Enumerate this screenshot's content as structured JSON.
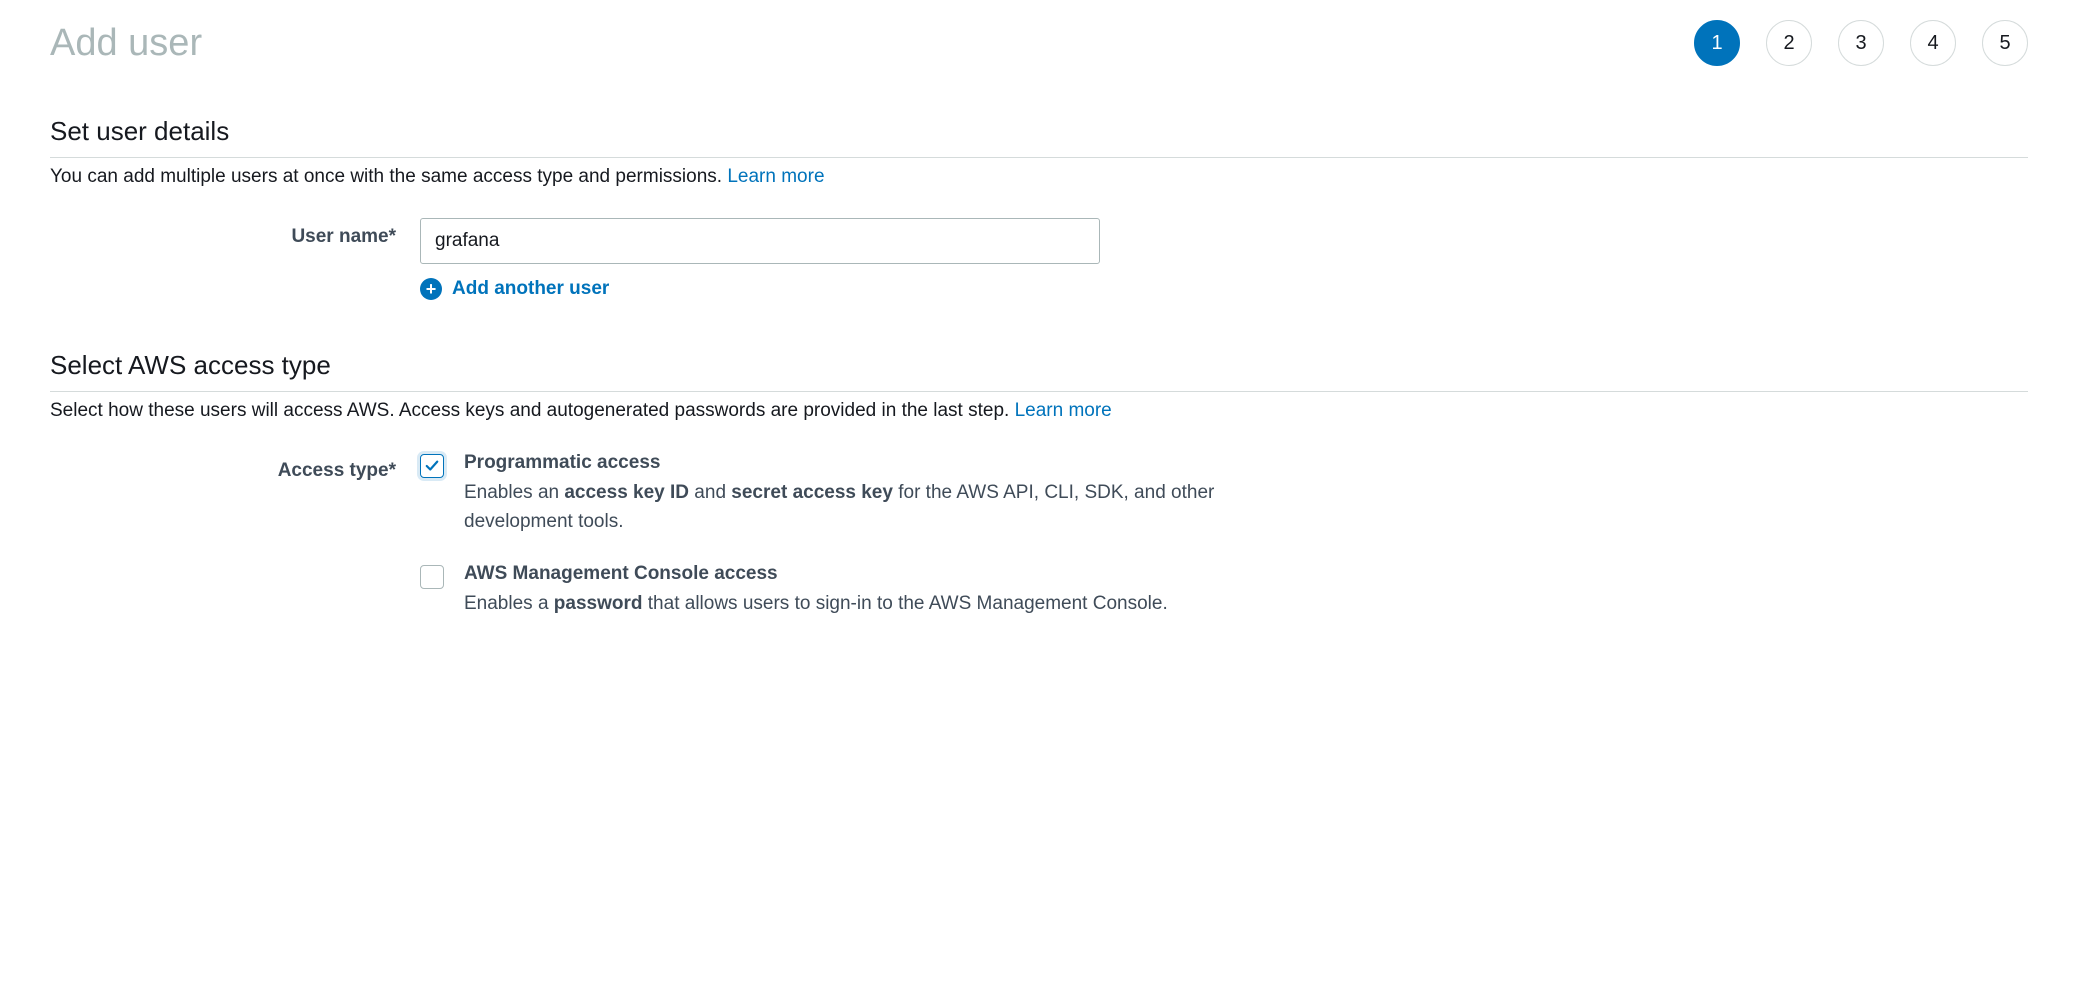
{
  "page_title": "Add user",
  "steps": [
    "1",
    "2",
    "3",
    "4",
    "5"
  ],
  "active_step_index": 0,
  "user_details": {
    "heading": "Set user details",
    "desc": "You can add multiple users at once with the same access type and permissions. ",
    "learn_more": "Learn more",
    "user_name_label": "User name*",
    "user_name_value": "grafana",
    "add_another_label": "Add another user"
  },
  "access_type": {
    "heading": "Select AWS access type",
    "desc": "Select how these users will access AWS. Access keys and autogenerated passwords are provided in the last step. ",
    "learn_more": "Learn more",
    "label": "Access type*",
    "options": [
      {
        "title": "Programmatic access",
        "desc_pre": "Enables an ",
        "desc_bold1": "access key ID",
        "desc_mid": " and ",
        "desc_bold2": "secret access key",
        "desc_post": " for the AWS API, CLI, SDK, and other development tools.",
        "checked": true
      },
      {
        "title": "AWS Management Console access",
        "desc_pre": "Enables a ",
        "desc_bold1": "password",
        "desc_mid": "",
        "desc_bold2": "",
        "desc_post": " that allows users to sign-in to the AWS Management Console.",
        "checked": false
      }
    ]
  }
}
